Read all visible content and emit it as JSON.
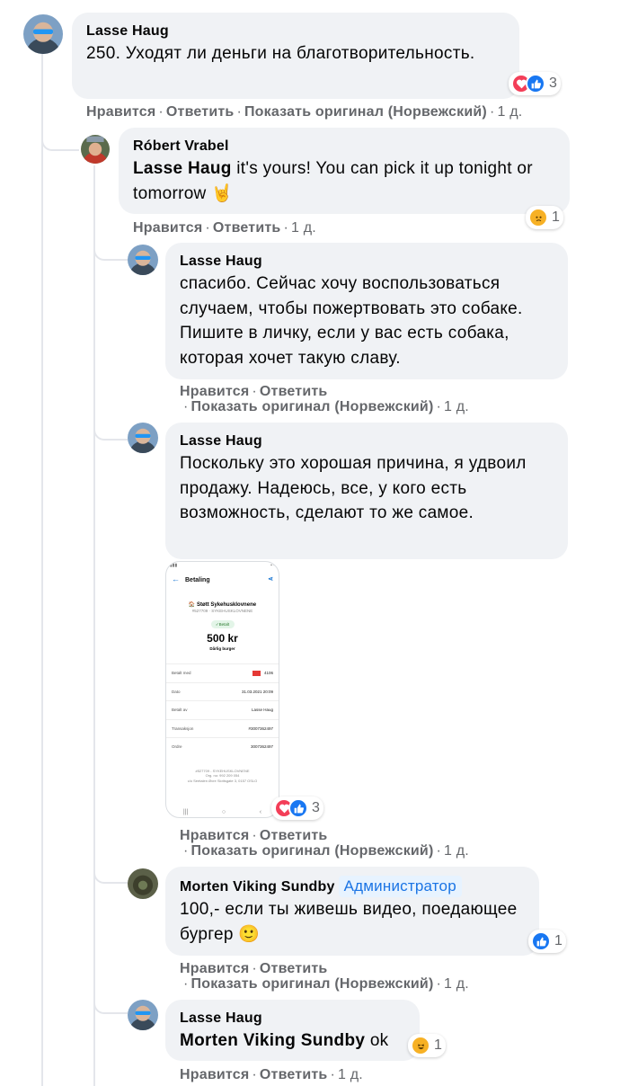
{
  "comments": [
    {
      "author": "Lasse Haug",
      "text": "250. Уходят ли деньги на благотворительность.",
      "reaction_count": "3",
      "actions": {
        "like": "Нравится",
        "reply": "Ответить",
        "translate": "Показать оригинал (Норвежский)",
        "time": "1 д."
      }
    },
    {
      "author": "Róbert Vrabel",
      "mention": "Lasse Haug",
      "text": "it's yours! You can pick it up tonight or tomorrow 🤘",
      "reaction_count": "1",
      "actions": {
        "like": "Нравится",
        "reply": "Ответить",
        "time": "1 д."
      }
    },
    {
      "author": "Lasse Haug",
      "text": "спасибо. Сейчас хочу воспользоваться случаем, чтобы пожертвовать это собаке. Пишите в личку, если у вас есть собака, которая хочет такую славу.",
      "actions": {
        "like": "Нравится",
        "reply": "Ответить",
        "translate": "Показать оригинал (Норвежский)",
        "time": "1 д."
      }
    },
    {
      "author": "Lasse Haug",
      "text": "Поскольку это хорошая причина, я удвоил продажу. Надеюсь, все, у кого есть возможность, сделают то же самое.",
      "reaction_count": "3",
      "actions": {
        "like": "Нравится",
        "reply": "Ответить",
        "translate": "Показать оригинал (Норвежский)",
        "time": "1 д."
      }
    },
    {
      "author": "Morten Viking Sundby",
      "badge": "Администратор",
      "text": "100,- если ты живешь видео, поедающее бургер 🙂",
      "reaction_count": "1",
      "actions": {
        "like": "Нравится",
        "reply": "Ответить",
        "translate": "Показать оригинал (Норвежский)",
        "time": "1 д."
      }
    },
    {
      "author": "Lasse Haug",
      "mention": "Morten Viking Sundby",
      "text": "ok",
      "reaction_count": "1",
      "actions": {
        "like": "Нравится",
        "reply": "Ответить",
        "time": "1 д."
      }
    }
  ],
  "attachment": {
    "title": "Betaling",
    "org": "Støtt Sykehusklovnene",
    "org_sub": "#527709 · SYKEHUSKLOVNENE",
    "status": "Betalt",
    "amount": "500 kr",
    "description": "Dårlig burger",
    "rows": [
      {
        "label": "Betalt med",
        "value": "4106"
      },
      {
        "label": "Dato",
        "value": "31.03.2021 20:09"
      },
      {
        "label": "Betalt av",
        "value": "Lasse Haug"
      },
      {
        "label": "Transaksjon",
        "value": "#3007362497"
      },
      {
        "label": "Ordre",
        "value": "3007362497"
      }
    ],
    "footer_line1": "#527709 - SYKEHUSKLOVNENE",
    "footer_line2": "Org. no: 992 209 054",
    "footer_line3": "c/o Seetalen Øvre Slottsgate 3, 0157 OSLO"
  },
  "colors": {
    "like": "#1877f2",
    "love": "#f33e58",
    "emoji": "#f7b125",
    "meta_text": "#65676b",
    "bubble": "#f0f2f5"
  }
}
